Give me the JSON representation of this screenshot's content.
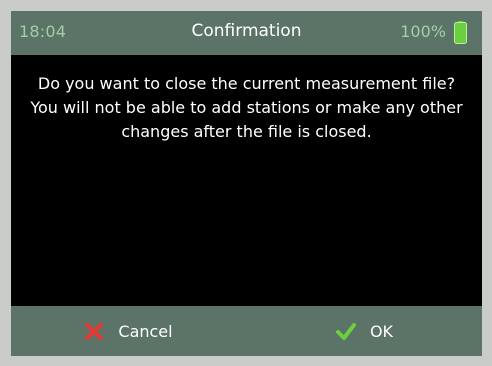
{
  "status": {
    "time": "18:04",
    "title": "Confirmation",
    "battery": "100%"
  },
  "dialog": {
    "message": "Do you want to close the current measurement file? You will not be able to add stations or make any other changes after the file is closed."
  },
  "buttons": {
    "cancel_label": "Cancel",
    "ok_label": "OK"
  },
  "colors": {
    "bar": "#5c7367",
    "background": "#000000",
    "accent_text": "#9fd0a8",
    "cancel_icon": "#e53935",
    "ok_icon": "#6ccf3f",
    "battery": "#6ccf3f"
  },
  "icons": {
    "battery": "battery-full-icon",
    "cancel": "red-x-icon",
    "ok": "green-check-icon"
  }
}
